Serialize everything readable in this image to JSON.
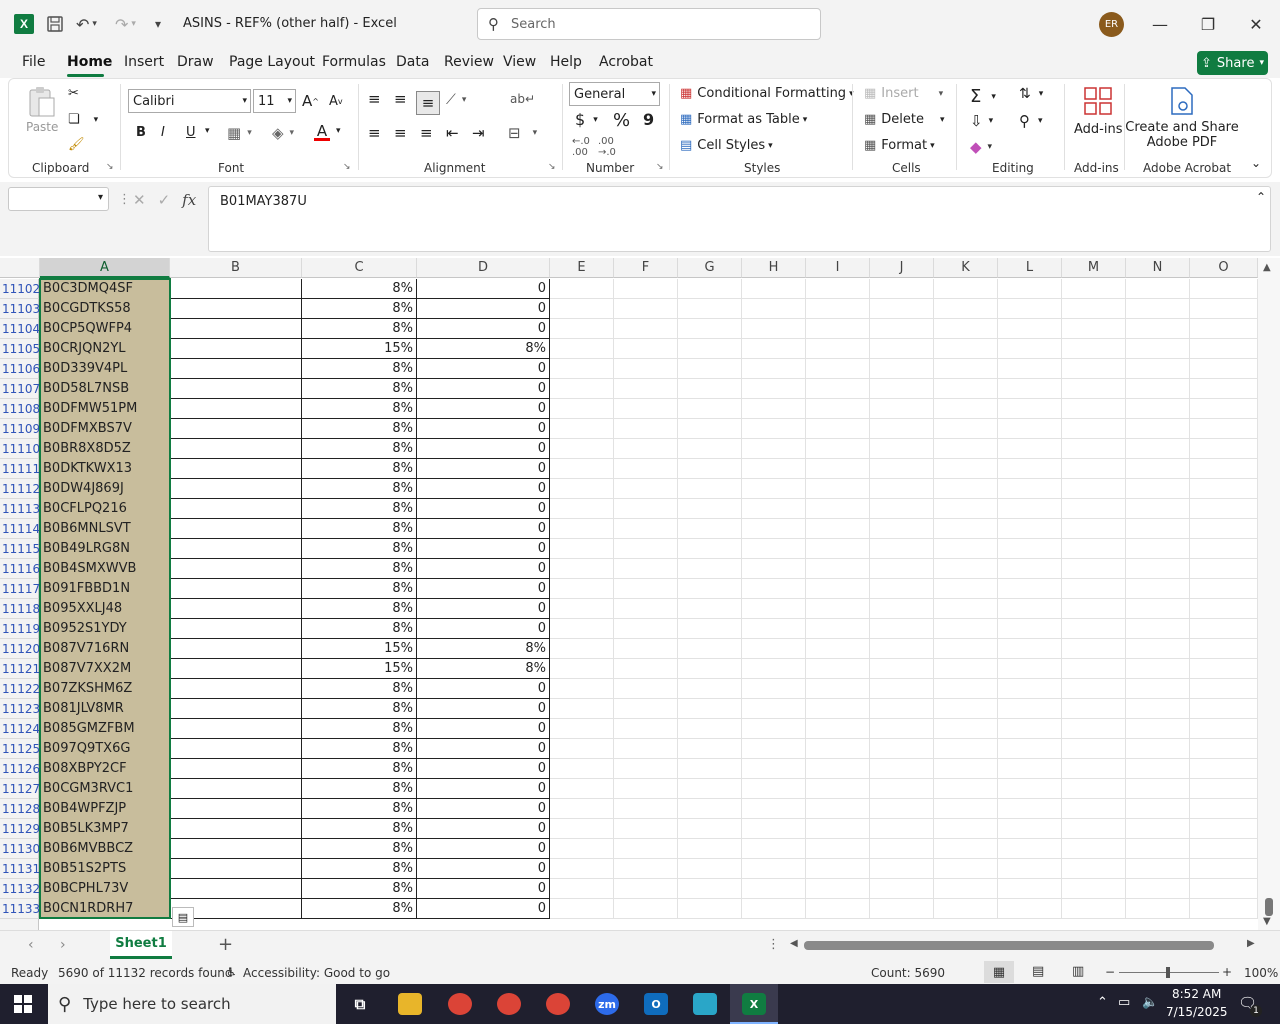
{
  "titlebar": {
    "app_letter": "X",
    "document_title": "ASINS - REF% (other half)  -  Excel",
    "search_placeholder": "Search",
    "avatar_initials": "ER"
  },
  "menu": {
    "items": [
      "File",
      "Home",
      "Insert",
      "Draw",
      "Page Layout",
      "Formulas",
      "Data",
      "Review",
      "View",
      "Help",
      "Acrobat"
    ],
    "active": "Home",
    "share_label": "Share"
  },
  "ribbon": {
    "clipboard": {
      "paste": "Paste",
      "label": "Clipboard"
    },
    "font": {
      "name": "Calibri",
      "size": "11",
      "label": "Font",
      "bold": "B",
      "italic": "I",
      "underline": "U"
    },
    "alignment": {
      "label": "Alignment"
    },
    "number": {
      "format": "General",
      "label": "Number",
      "currency": "$",
      "percent": "%",
      "comma": "9"
    },
    "styles": {
      "conditional": "Conditional Formatting",
      "format_table": "Format as Table",
      "cell_styles": "Cell Styles",
      "label": "Styles"
    },
    "cells": {
      "insert": "Insert",
      "delete": "Delete",
      "format": "Format",
      "label": "Cells"
    },
    "editing": {
      "label": "Editing"
    },
    "addins": {
      "button": "Add-ins",
      "label": "Add-ins"
    },
    "acrobat": {
      "button_line1": "Create and Share",
      "button_line2": "Adobe PDF",
      "label": "Adobe Acrobat"
    }
  },
  "formula_bar": {
    "name_box": "",
    "fx": "fx",
    "content": "B01MAY387U"
  },
  "columns": [
    "A",
    "B",
    "C",
    "D",
    "E",
    "F",
    "G",
    "H",
    "I",
    "J",
    "K",
    "L",
    "M",
    "N",
    "O"
  ],
  "rows": [
    {
      "n": "11102",
      "a": "B0C3DMQ4SF",
      "c": "8%",
      "d": "0"
    },
    {
      "n": "11103",
      "a": "B0CGDTKS58",
      "c": "8%",
      "d": "0"
    },
    {
      "n": "11104",
      "a": "B0CP5QWFP4",
      "c": "8%",
      "d": "0"
    },
    {
      "n": "11105",
      "a": "B0CRJQN2YL",
      "c": "15%",
      "d": "8%"
    },
    {
      "n": "11106",
      "a": "B0D339V4PL",
      "c": "8%",
      "d": "0"
    },
    {
      "n": "11107",
      "a": "B0D58L7NSB",
      "c": "8%",
      "d": "0"
    },
    {
      "n": "11108",
      "a": "B0DFMW51PM",
      "c": "8%",
      "d": "0"
    },
    {
      "n": "11109",
      "a": "B0DFMXBS7V",
      "c": "8%",
      "d": "0"
    },
    {
      "n": "11110",
      "a": "B0BR8X8D5Z",
      "c": "8%",
      "d": "0"
    },
    {
      "n": "11111",
      "a": "B0DKTKWX13",
      "c": "8%",
      "d": "0"
    },
    {
      "n": "11112",
      "a": "B0DW4J869J",
      "c": "8%",
      "d": "0"
    },
    {
      "n": "11113",
      "a": "B0CFLPQ216",
      "c": "8%",
      "d": "0"
    },
    {
      "n": "11114",
      "a": "B0B6MNLSVT",
      "c": "8%",
      "d": "0"
    },
    {
      "n": "11115",
      "a": "B0B49LRG8N",
      "c": "8%",
      "d": "0"
    },
    {
      "n": "11116",
      "a": "B0B4SMXWVB",
      "c": "8%",
      "d": "0"
    },
    {
      "n": "11117",
      "a": "B091FBBD1N",
      "c": "8%",
      "d": "0"
    },
    {
      "n": "11118",
      "a": "B095XXLJ48",
      "c": "8%",
      "d": "0"
    },
    {
      "n": "11119",
      "a": "B0952S1YDY",
      "c": "8%",
      "d": "0"
    },
    {
      "n": "11120",
      "a": "B087V716RN",
      "c": "15%",
      "d": "8%"
    },
    {
      "n": "11121",
      "a": "B087V7XX2M",
      "c": "15%",
      "d": "8%"
    },
    {
      "n": "11122",
      "a": "B07ZKSHM6Z",
      "c": "8%",
      "d": "0"
    },
    {
      "n": "11123",
      "a": "B081JLV8MR",
      "c": "8%",
      "d": "0"
    },
    {
      "n": "11124",
      "a": "B085GMZFBM",
      "c": "8%",
      "d": "0"
    },
    {
      "n": "11125",
      "a": "B097Q9TX6G",
      "c": "8%",
      "d": "0"
    },
    {
      "n": "11126",
      "a": "B08XBPY2CF",
      "c": "8%",
      "d": "0"
    },
    {
      "n": "11127",
      "a": "B0CGM3RVC1",
      "c": "8%",
      "d": "0"
    },
    {
      "n": "11128",
      "a": "B0B4WPFZJP",
      "c": "8%",
      "d": "0"
    },
    {
      "n": "11129",
      "a": "B0B5LK3MP7",
      "c": "8%",
      "d": "0"
    },
    {
      "n": "11130",
      "a": "B0B6MVBBCZ",
      "c": "8%",
      "d": "0"
    },
    {
      "n": "11131",
      "a": "B0B51S2PTS",
      "c": "8%",
      "d": "0"
    },
    {
      "n": "11132",
      "a": "B0BCPHL73V",
      "c": "8%",
      "d": "0"
    },
    {
      "n": "11133",
      "a": "B0CN1RDRH7",
      "c": "8%",
      "d": "0"
    }
  ],
  "sheet_tabs": {
    "active": "Sheet1",
    "add": "+"
  },
  "status": {
    "mode": "Ready",
    "filter": "5690 of 11132 records found",
    "accessibility": "Accessibility: Good to go",
    "count": "Count: 5690",
    "zoom": "100%",
    "zoom_minus": "−",
    "zoom_plus": "+"
  },
  "taskbar": {
    "search_placeholder": "Type here to search",
    "time": "8:52 AM",
    "date": "7/15/2025",
    "notification_count": "1",
    "zoom_app": "zm",
    "excel_app": "X",
    "outlook_app": "O"
  },
  "colors": {
    "excel_green": "#107c41",
    "selection": "#c8bd9c",
    "taskbar": "#1f1f2e"
  }
}
